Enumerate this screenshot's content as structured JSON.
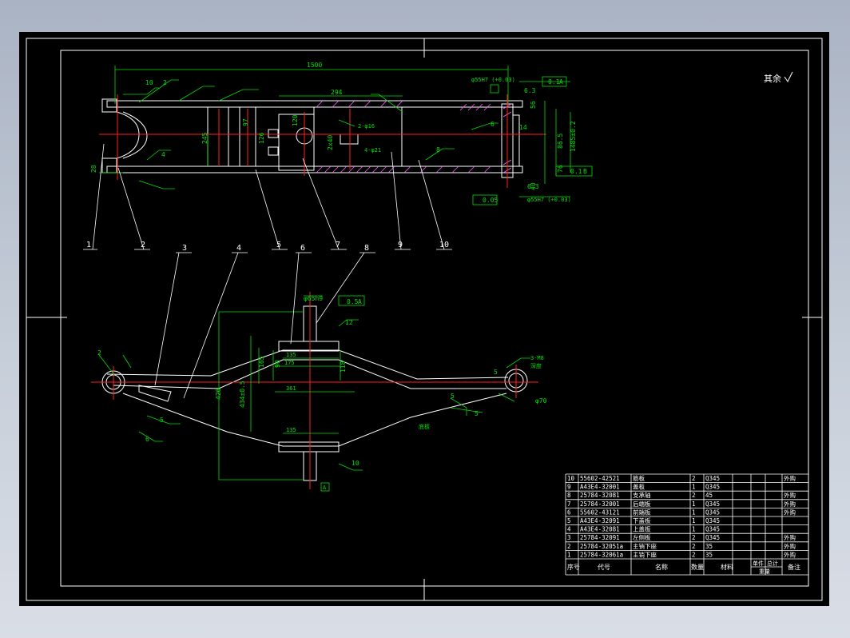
{
  "colors": {
    "background": "#000000",
    "frame": "#ffffff",
    "centerline": "#ff2020",
    "dimension": "#00e000",
    "hatch": "#ff60ff",
    "text": "#ffffff",
    "table_text": "#ffffff"
  },
  "top_view": {
    "overall_length": "1500",
    "dim_294": "294",
    "dim_97": "97",
    "dim_120": "120",
    "dim_10": "10",
    "dim_245": "245",
    "dim_126": "126",
    "dim_28": "28",
    "dim_140": "2x40",
    "dim_1485": "1485±0.2",
    "dim_86_5": "86.5",
    "dim_76": "76",
    "dim_40": "40",
    "dim_56": "56",
    "dim_6_3a": "6.3",
    "dim_6_3b": "6.3",
    "dim_14": "14",
    "bore_top": "φ55H7 (+0.03)",
    "bore_bottom": "φ55H7 (+0.03)",
    "tol_perp_top": "0.1",
    "tol_perp_top_ref": "A",
    "tol_perp_bottom": "0.1",
    "tol_perp_bottom_ref": "B",
    "tol_flat": "0.05",
    "weld_10": "10",
    "weld_2_top": "2",
    "weld_4": "4",
    "weld_8": "8",
    "weld_6": "6",
    "hole_note": "2-φ16",
    "hole_note2": "4-φ21",
    "roughness_note": "其余",
    "callouts": [
      "1",
      "2",
      "5",
      "7",
      "9",
      "10"
    ]
  },
  "front_view": {
    "dim_phi65": "φ65h9",
    "dim_phi70": "φ70",
    "tol_coax": "0.5",
    "tol_coax_ref": "A",
    "dim_135_top": "135",
    "dim_175": "175",
    "dim_361": "361",
    "dim_135_bot": "135",
    "dim_90": "90",
    "dim_118": "118",
    "dim_165": "165",
    "dim_426": "426",
    "dim_434": "434±0.5",
    "dim_5a": "5",
    "dim_5b": "5",
    "dim_5c": "5",
    "weld_12": "12",
    "weld_10": "10",
    "weld_5": "5",
    "weld_6": "6",
    "weld_2": "2",
    "hole_note": "3-M8",
    "note_right": "深度",
    "note_mid": "底板",
    "datum": "A",
    "callouts": [
      "3",
      "4",
      "6",
      "8"
    ]
  },
  "parts_table": {
    "headers": [
      "序号",
      "代号",
      "名称",
      "数量",
      "材料",
      "单件",
      "总计",
      "备注"
    ],
    "sub_header": "重量",
    "rows": [
      [
        "10",
        "55602-42521",
        "筋板",
        "2",
        "Q345",
        "",
        "",
        "外购"
      ],
      [
        "9",
        "A43E4-32001",
        "盖板",
        "1",
        "Q345",
        "",
        "",
        ""
      ],
      [
        "8",
        "25784-32081",
        "支承轴",
        "2",
        "45",
        "",
        "",
        "外购"
      ],
      [
        "7",
        "25784-32001",
        "后端板",
        "1",
        "Q345",
        "",
        "",
        "外购"
      ],
      [
        "6",
        "55602-43121",
        "前端板",
        "1",
        "Q345",
        "",
        "",
        "外购"
      ],
      [
        "5",
        "A43E4-32091",
        "下盖板",
        "1",
        "Q345",
        "",
        "",
        ""
      ],
      [
        "4",
        "A43E4-32081",
        "上盖板",
        "1",
        "Q345",
        "",
        "",
        ""
      ],
      [
        "3",
        "25784-32091",
        "左侧板",
        "2",
        "Q345",
        "",
        "",
        "外购"
      ],
      [
        "2",
        "25784-32051a",
        "主销下座",
        "2",
        "35",
        "",
        "",
        "外购"
      ],
      [
        "1",
        "25784-32061a",
        "主销下座",
        "2",
        "35",
        "",
        "",
        "外购"
      ]
    ]
  }
}
